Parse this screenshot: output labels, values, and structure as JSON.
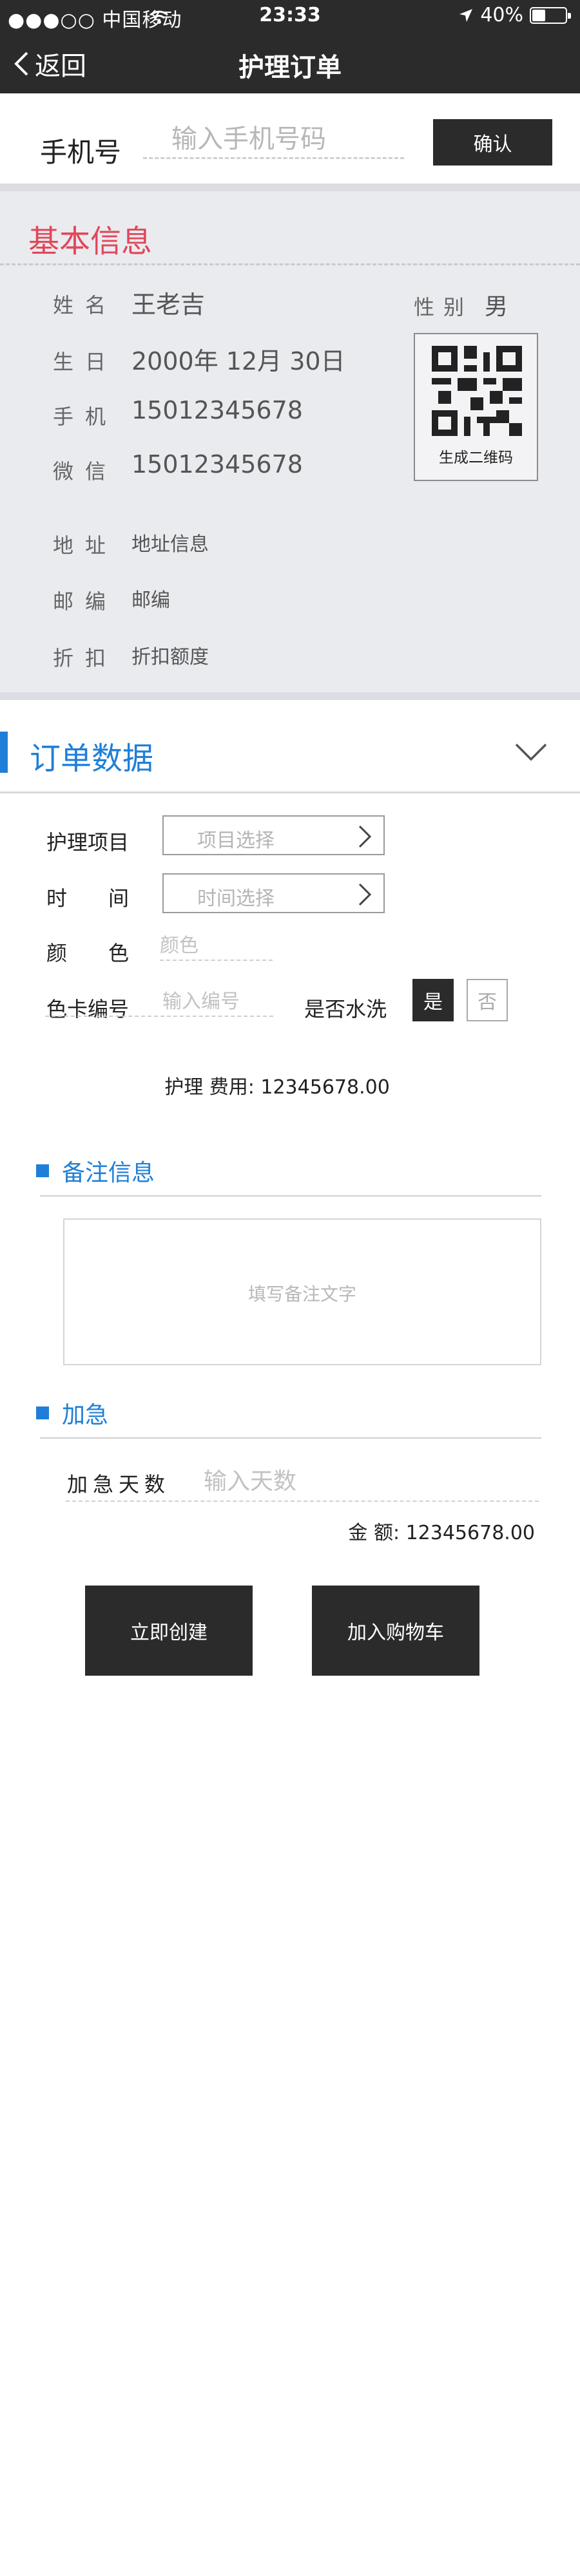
{
  "status_bar": {
    "carrier": "●●●○○ 中国移动",
    "time": "23:33",
    "battery": "40%",
    "battery_level": 0.4
  },
  "nav": {
    "back_label": "返回",
    "title": "护理订单"
  },
  "phone": {
    "label": "手机号",
    "placeholder": "输入手机号码",
    "confirm_label": "确认"
  },
  "basic_info": {
    "title": "基本信息",
    "name_label": "姓名",
    "name_value": "王老吉",
    "gender_label": "性别",
    "gender_value": "男",
    "birth_label": "生日",
    "birth_value": "2000年 12月 30日",
    "mobile_label": "手机",
    "mobile_value": "15012345678",
    "wechat_label": "微信",
    "wechat_value": "15012345678",
    "address_label": "地址",
    "address_value": "地址信息",
    "postcode_label": "邮编",
    "postcode_value": "邮编",
    "discount_label": "折扣",
    "discount_value": "折扣额度",
    "qr_label": "生成二维码"
  },
  "order": {
    "title": "订单数据",
    "project_label": "护理项目",
    "project_placeholder": "项目选择",
    "time_label": "时　　间",
    "time_placeholder": "时间选择",
    "color_label": "颜　　色",
    "color_placeholder": "颜色",
    "card_label": "色卡编号",
    "card_placeholder": "输入编号",
    "wash_label": "是否水洗",
    "wash_yes": "是",
    "wash_no": "否",
    "fee_text": "护理 费用:  12345678.00"
  },
  "remark": {
    "title": "备注信息",
    "placeholder": "填写备注文字"
  },
  "rush": {
    "title": "加急",
    "days_label": "加急天数",
    "days_placeholder": "输入天数",
    "amount_text": "金 额:  12345678.00"
  },
  "actions": {
    "create_label": "立即创建",
    "cart_label": "加入购物车"
  },
  "colors": {
    "accent_blue": "#1f7fd8",
    "accent_red": "#e0485b",
    "dark": "#2b2b2b"
  }
}
